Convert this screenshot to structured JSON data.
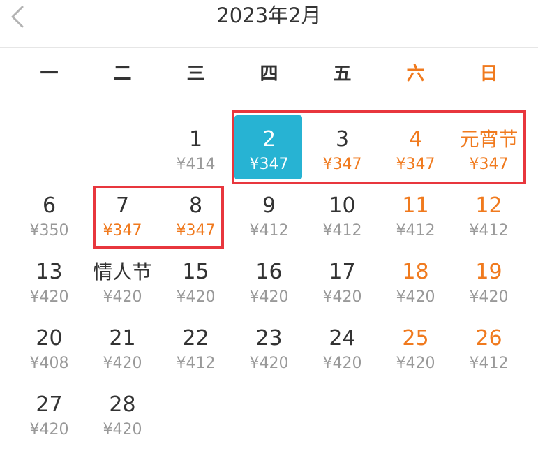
{
  "header": {
    "title": "2023年2月",
    "back_icon": "chevron-left-icon"
  },
  "weekdays": [
    {
      "label": "一",
      "weekend": false
    },
    {
      "label": "二",
      "weekend": false
    },
    {
      "label": "三",
      "weekend": false
    },
    {
      "label": "四",
      "weekend": false
    },
    {
      "label": "五",
      "weekend": false
    },
    {
      "label": "六",
      "weekend": true
    },
    {
      "label": "日",
      "weekend": true
    }
  ],
  "colors": {
    "accent": "#27b3d3",
    "weekend": "#f07a1e",
    "highlight_border": "#e8363d",
    "text": "#333333",
    "price": "#999999"
  },
  "weeks": [
    [
      null,
      null,
      {
        "day": "1",
        "price": "¥414",
        "style": "normal"
      },
      {
        "day": "2",
        "price": "¥347",
        "style": "selected"
      },
      {
        "day": "3",
        "price": "¥347",
        "style": "orange-price"
      },
      {
        "day": "4",
        "price": "¥347",
        "style": "orange"
      },
      {
        "day": "元宵节",
        "price": "¥347",
        "style": "orange",
        "festival": true
      }
    ],
    [
      {
        "day": "6",
        "price": "¥350",
        "style": "normal"
      },
      {
        "day": "7",
        "price": "¥347",
        "style": "orange-price"
      },
      {
        "day": "8",
        "price": "¥347",
        "style": "orange-price"
      },
      {
        "day": "9",
        "price": "¥412",
        "style": "normal"
      },
      {
        "day": "10",
        "price": "¥412",
        "style": "normal"
      },
      {
        "day": "11",
        "price": "¥412",
        "style": "weekend"
      },
      {
        "day": "12",
        "price": "¥412",
        "style": "weekend"
      }
    ],
    [
      {
        "day": "13",
        "price": "¥420",
        "style": "normal"
      },
      {
        "day": "情人节",
        "price": "¥420",
        "style": "normal",
        "festival": true
      },
      {
        "day": "15",
        "price": "¥420",
        "style": "normal"
      },
      {
        "day": "16",
        "price": "¥420",
        "style": "normal"
      },
      {
        "day": "17",
        "price": "¥420",
        "style": "normal"
      },
      {
        "day": "18",
        "price": "¥420",
        "style": "weekend"
      },
      {
        "day": "19",
        "price": "¥420",
        "style": "weekend"
      }
    ],
    [
      {
        "day": "20",
        "price": "¥408",
        "style": "normal"
      },
      {
        "day": "21",
        "price": "¥420",
        "style": "normal"
      },
      {
        "day": "22",
        "price": "¥412",
        "style": "normal"
      },
      {
        "day": "23",
        "price": "¥420",
        "style": "normal"
      },
      {
        "day": "24",
        "price": "¥420",
        "style": "normal"
      },
      {
        "day": "25",
        "price": "¥420",
        "style": "weekend"
      },
      {
        "day": "26",
        "price": "¥412",
        "style": "weekend"
      }
    ],
    [
      {
        "day": "27",
        "price": "¥420",
        "style": "normal"
      },
      {
        "day": "28",
        "price": "¥420",
        "style": "normal"
      },
      null,
      null,
      null,
      null,
      null
    ]
  ]
}
